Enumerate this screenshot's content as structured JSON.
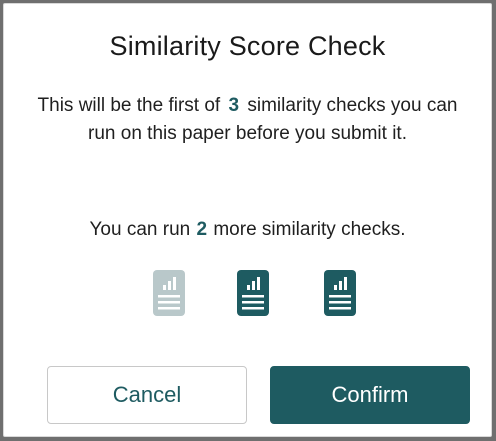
{
  "dialog": {
    "title": "Similarity Score Check",
    "description_part1": "This will be the first of",
    "description_count": "3",
    "description_part2": "similarity checks you can run on this paper before you submit it.",
    "remaining_prefix": "You can run",
    "remaining_count": "2",
    "remaining_suffix": "more similarity checks.",
    "check_icons": [
      {
        "name": "similarity-check-used-icon",
        "state": "used",
        "color": "#b9c8ca"
      },
      {
        "name": "similarity-check-available-icon",
        "state": "available",
        "color": "#1e5b61"
      },
      {
        "name": "similarity-check-available-icon",
        "state": "available",
        "color": "#1e5b61"
      }
    ],
    "cancel_label": "Cancel",
    "confirm_label": "Confirm"
  },
  "colors": {
    "accent": "#1e5b61",
    "used_icon": "#b9c8ca",
    "backdrop": "#6f6f6f"
  }
}
